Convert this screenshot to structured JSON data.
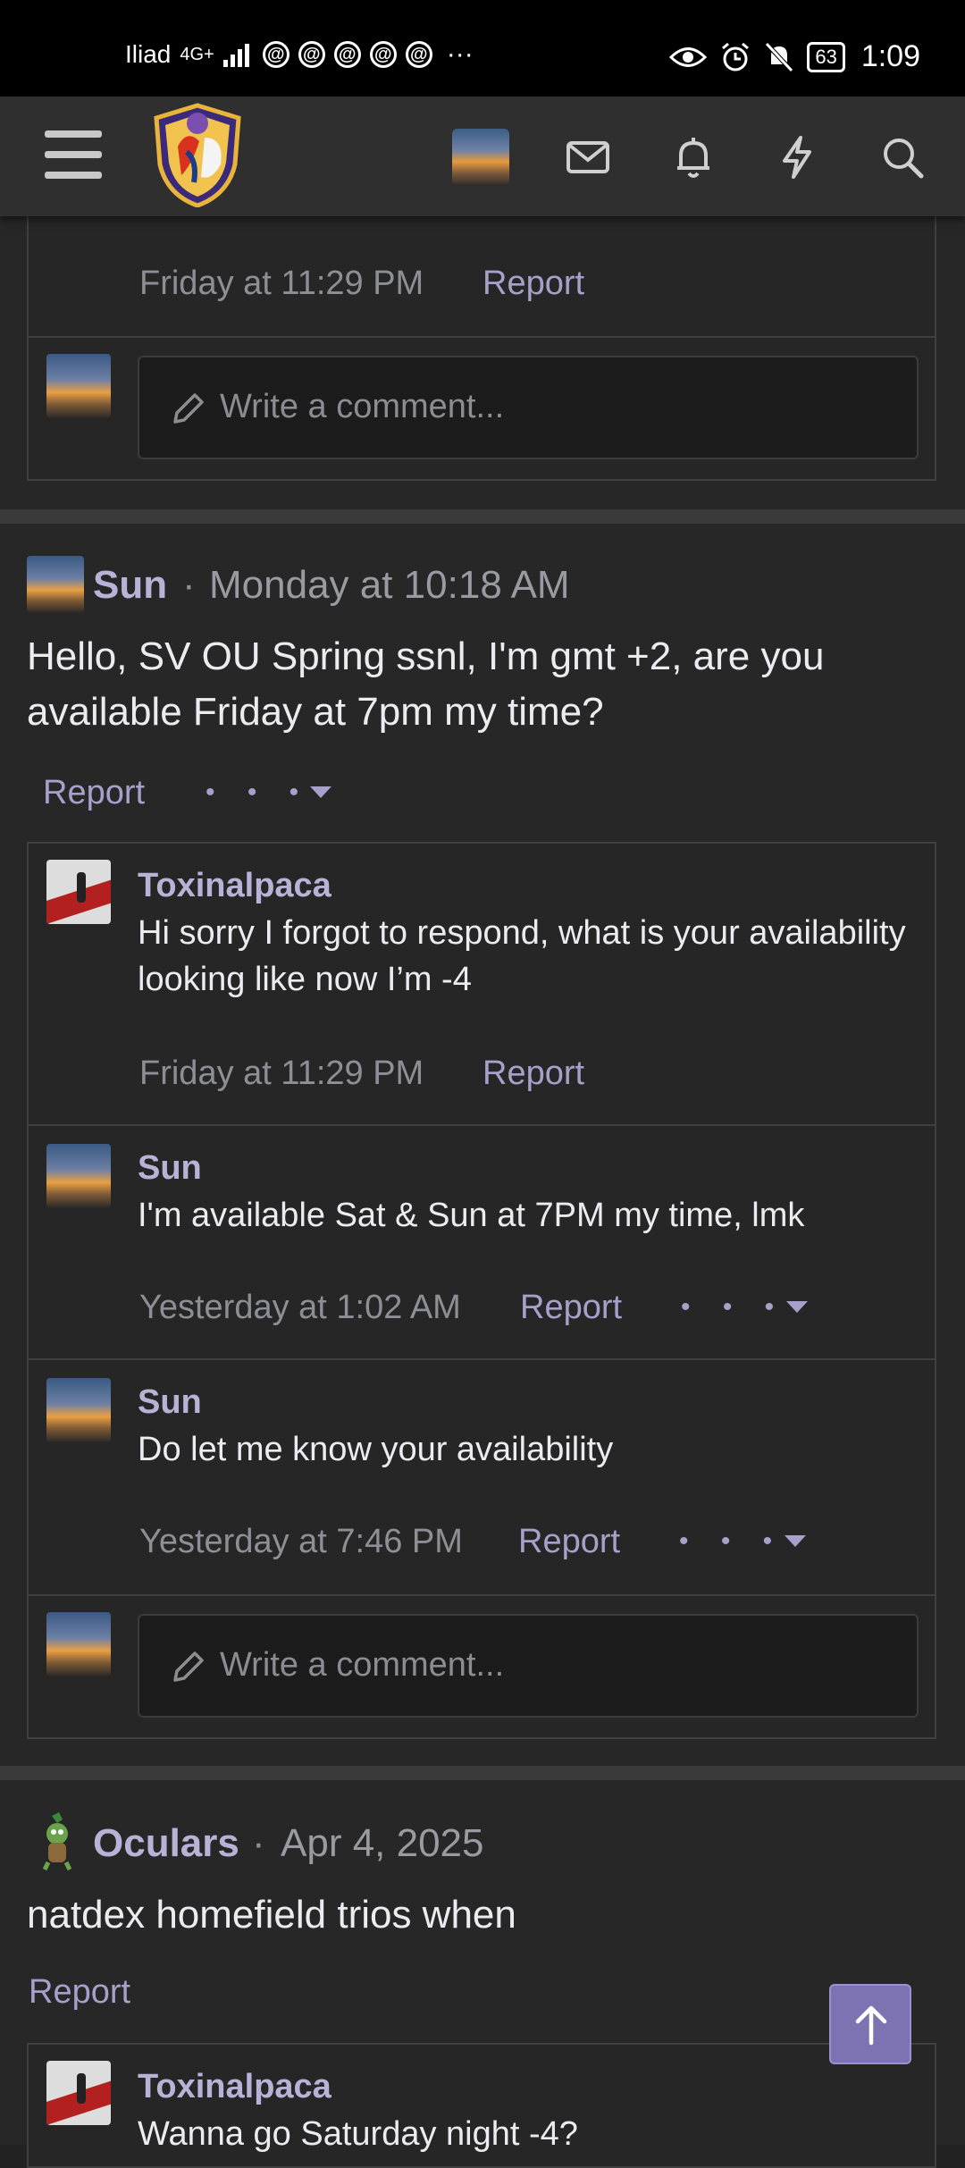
{
  "status_bar": {
    "carrier": "Iliad",
    "network": "4G+",
    "threads_icons": [
      "@",
      "@",
      "@",
      "@",
      "@"
    ],
    "more": "···",
    "battery": "63",
    "time": "1:09"
  },
  "nav": {
    "icons": [
      "menu-icon",
      "site-logo",
      "user-avatar",
      "mail-icon",
      "bell-icon",
      "bolt-icon",
      "search-icon"
    ]
  },
  "thread1": {
    "timestamp": "Friday at 11:29 PM",
    "report": "Report",
    "comment_placeholder": "Write a comment..."
  },
  "post1": {
    "author": "Sun",
    "separator": "·",
    "date": "Monday at 10:18 AM",
    "body": "Hello, SV OU Spring ssnl, I'm gmt +2, are you available Friday at 7pm my time?",
    "report": "Report",
    "dots": "• • •",
    "comments": [
      {
        "author": "Toxinalpaca",
        "text": "Hi sorry I forgot to respond, what is your availability looking like now I’m -4",
        "time": "Friday at 11:29 PM",
        "report": "Report"
      },
      {
        "author": "Sun",
        "text": "I'm available Sat & Sun at 7PM my time, lmk",
        "time": "Yesterday at 1:02 AM",
        "report": "Report",
        "dots": "• • •"
      },
      {
        "author": "Sun",
        "text": "Do let me know your availability",
        "time": "Yesterday at 7:46 PM",
        "report": "Report",
        "dots": "• • •"
      }
    ],
    "comment_placeholder": "Write a comment..."
  },
  "post2": {
    "author": "Oculars",
    "separator": "·",
    "date": "Apr 4, 2025",
    "body": "natdex homefield trios when",
    "report": "Report",
    "comments": [
      {
        "author": "Toxinalpaca",
        "text": "Wanna go Saturday night -4?"
      }
    ]
  },
  "colors": {
    "accent": "#b8b3d6",
    "link": "#a6a0ca",
    "background": "#222222",
    "scroll_button": "#7d73b3"
  }
}
